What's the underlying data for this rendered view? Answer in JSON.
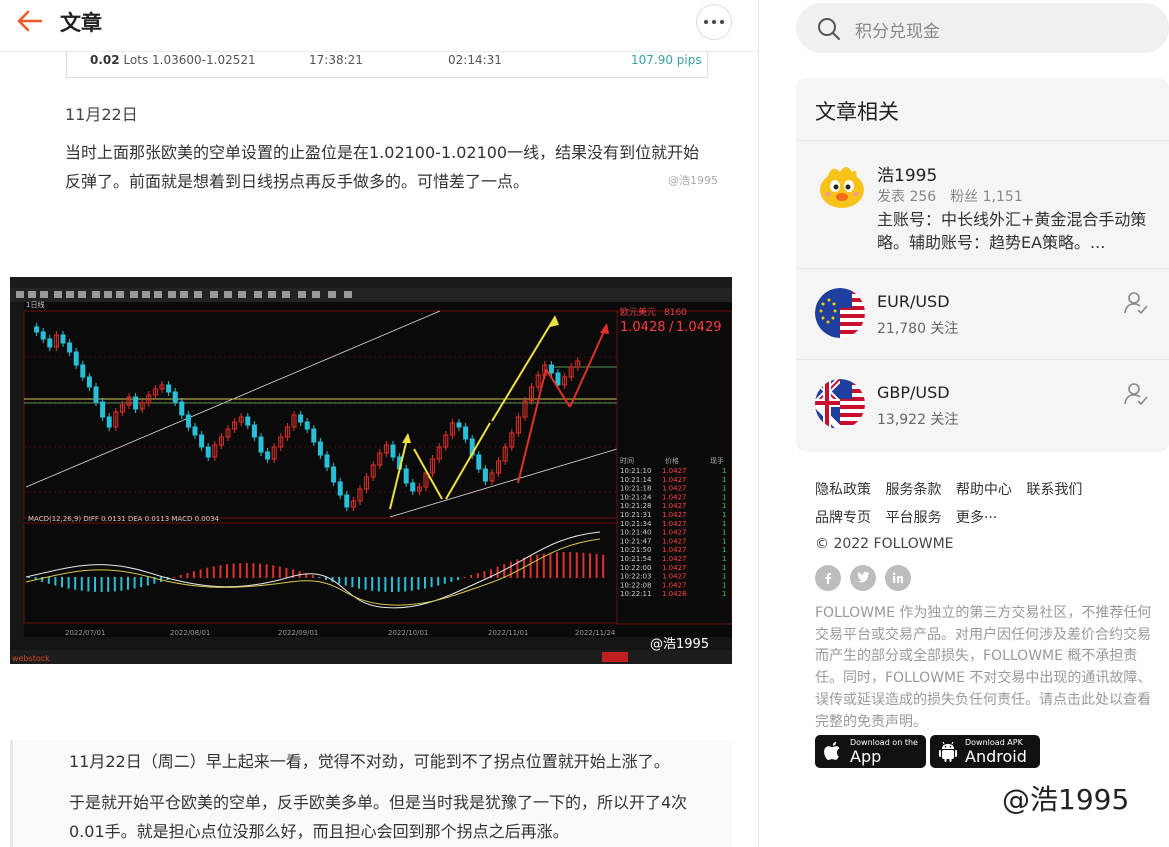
{
  "header": {
    "title": "文章"
  },
  "trade_strip": {
    "lots_value": "0.02",
    "lots_unit": "Lots",
    "price_range": "1.03600-1.02521",
    "open_time": "17:38:21",
    "duration": "02:14:31",
    "pips": "107.90 pips"
  },
  "article": {
    "date1": "11月22日",
    "para1": "当时上面那张欧美的空单设置的止盈位是在1.02100-1.02100一线，结果没有到位就开始反弹了。前面就是想着到日线拐点再反手做多的。可惜差了一点。",
    "watermark1": "@浩1995",
    "quote_line1": "11月22日（周二）早上起来一看，觉得不对劲，可能到不了拐点位置就开始上涨了。",
    "quote_line2": "于是就开始平仓欧美的空单，反手欧美多单。但是当时我是犹豫了一下的，所以开了4次0.01手。就是担心点位没那么好，而且担心会回到那个拐点之后再涨。"
  },
  "chart_image": {
    "symbol": "欧元美元",
    "symbol_code": "8160",
    "bid": "1.0428",
    "ask": "1.0429",
    "macd_label": "MACD(12,26,9)  DIFF 0.0131  DEA 0.0113  MACD 0.0034",
    "period_label": "1日线",
    "dates": [
      "2022/07/01",
      "2022/08/01",
      "2022/09/01",
      "2022/10/01",
      "2022/11/01",
      "2022/11/24"
    ],
    "ticks": [
      {
        "t": "10:21:10",
        "p": "1.0427",
        "v": "1"
      },
      {
        "t": "10:21:14",
        "p": "1.0427",
        "v": "1"
      },
      {
        "t": "10:21:18",
        "p": "1.0427",
        "v": "1"
      },
      {
        "t": "10:21:24",
        "p": "1.0427",
        "v": "1"
      },
      {
        "t": "10:21:28",
        "p": "1.0427",
        "v": "1"
      },
      {
        "t": "10:21:31",
        "p": "1.0427",
        "v": "1"
      },
      {
        "t": "10:21:34",
        "p": "1.0427",
        "v": "1"
      },
      {
        "t": "10:21:40",
        "p": "1.0427",
        "v": "1"
      },
      {
        "t": "10:21:47",
        "p": "1.0427",
        "v": "1"
      },
      {
        "t": "10:21:50",
        "p": "1.0427",
        "v": "1"
      },
      {
        "t": "10:21:54",
        "p": "1.0427",
        "v": "1"
      },
      {
        "t": "10:22:00",
        "p": "1.0427",
        "v": "1"
      },
      {
        "t": "10:22:03",
        "p": "1.0427",
        "v": "1"
      },
      {
        "t": "10:22:08",
        "p": "1.0427",
        "v": "1"
      },
      {
        "t": "10:22:11",
        "p": "1.0428",
        "v": "1"
      }
    ],
    "tick_headers": [
      "时间",
      "价格",
      "现手"
    ],
    "watermark": "@浩1995",
    "brand": "webstock"
  },
  "search": {
    "placeholder": "积分兑现金"
  },
  "related": {
    "title": "文章相关",
    "author": {
      "name": "浩1995",
      "posts_label": "发表",
      "posts": "256",
      "fans_label": "粉丝",
      "fans": "1,151",
      "bio": "主账号：中长线外汇+黄金混合手动策略。辅助账号：趋势EA策略。..."
    },
    "instruments": [
      {
        "name": "EUR/USD",
        "followers": "21,780 关注"
      },
      {
        "name": "GBP/USD",
        "followers": "13,922 关注"
      }
    ]
  },
  "footer": {
    "links_row1": [
      "隐私政策",
      "服务条款",
      "帮助中心",
      "联系我们"
    ],
    "links_row2": [
      "品牌专页",
      "平台服务",
      "更多···"
    ],
    "copyright": "© 2022 FOLLOWME",
    "disclaimer": "FOLLOWME 作为独立的第三方交易社区，不推荐任何交易平台或交易产品。对用户因任何涉及差价合约交易而产生的部分或全部损失，FOLLOWME 概不承担责任。同时，FOLLOWME 不对交易中出现的通讯故障、误传或延误造成的损失负任何责任。请点击此处以查看完整的免责声明。",
    "app_store_small": "Download on the",
    "app_store_big": "App Store",
    "android_small": "Download APK",
    "android_big": "Android",
    "signature": "@浩1995"
  },
  "colors": {
    "accent_orange": "#f05a28",
    "teal": "#3aa3a8"
  }
}
